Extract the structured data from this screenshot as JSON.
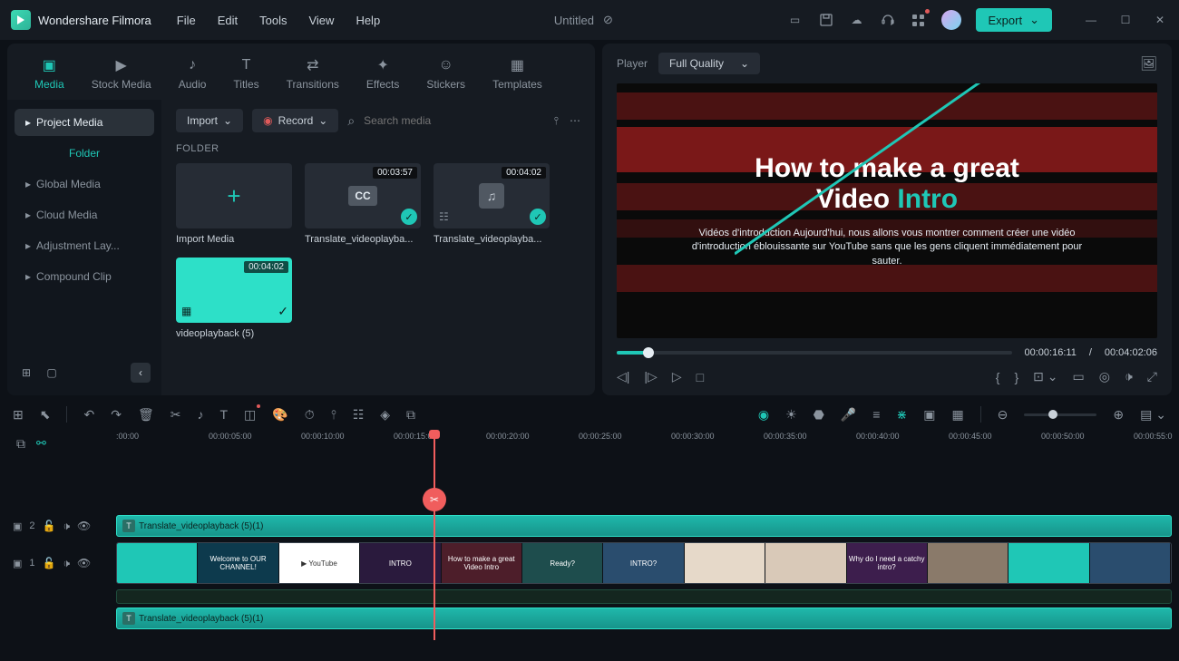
{
  "app": {
    "name": "Wondershare Filmora",
    "document": "Untitled"
  },
  "menu": {
    "file": "File",
    "edit": "Edit",
    "tools": "Tools",
    "view": "View",
    "help": "Help"
  },
  "export_label": "Export",
  "tabs": {
    "media": "Media",
    "stock": "Stock Media",
    "audio": "Audio",
    "titles": "Titles",
    "transitions": "Transitions",
    "effects": "Effects",
    "stickers": "Stickers",
    "templates": "Templates"
  },
  "sidebar": {
    "project_media": "Project Media",
    "folder": "Folder",
    "global": "Global Media",
    "cloud": "Cloud Media",
    "adjustment": "Adjustment Lay...",
    "compound": "Compound Clip"
  },
  "media_toolbar": {
    "import": "Import",
    "record": "Record",
    "search_placeholder": "Search media"
  },
  "media_heading": "FOLDER",
  "cards": {
    "import": "Import Media",
    "c1": {
      "dur": "00:03:57",
      "label": "Translate_videoplayba..."
    },
    "c2": {
      "dur": "00:04:02",
      "label": "Translate_videoplayba..."
    },
    "c3": {
      "dur": "00:04:02",
      "label": "videoplayback (5)"
    }
  },
  "player": {
    "label": "Player",
    "quality": "Full Quality",
    "title_l1": "How to make a great",
    "title_l2a": "Video ",
    "title_l2b": "Intro",
    "subtitle": "Vidéos d'introduction Aujourd'hui, nous allons vous montrer comment créer une vidéo d'introduction éblouissante sur YouTube sans que les gens cliquent immédiatement pour sauter.",
    "current": "00:00:16:11",
    "sep": "/",
    "total": "00:04:02:06"
  },
  "ruler": [
    ":00:00",
    "00:00:05:00",
    "00:00:10:00",
    "00:00:15:00",
    "00:00:20:00",
    "00:00:25:00",
    "00:00:30:00",
    "00:00:35:00",
    "00:00:40:00",
    "00:00:45:00",
    "00:00:50:00",
    "00:00:55:0"
  ],
  "tracks": {
    "t2": "2",
    "t1": "1",
    "clip2_label": "Translate_videoplayback (5)(1)",
    "clip3_label": "Translate_videoplayback (5)(1)",
    "thumbs": [
      "",
      "Welcome to OUR CHANNEL!",
      "▶ YouTube",
      "INTRO",
      "How to make a great Video Intro",
      "Ready?",
      "INTRO?",
      "",
      "",
      "Why do I need a catchy intro?",
      "",
      "",
      ""
    ]
  }
}
